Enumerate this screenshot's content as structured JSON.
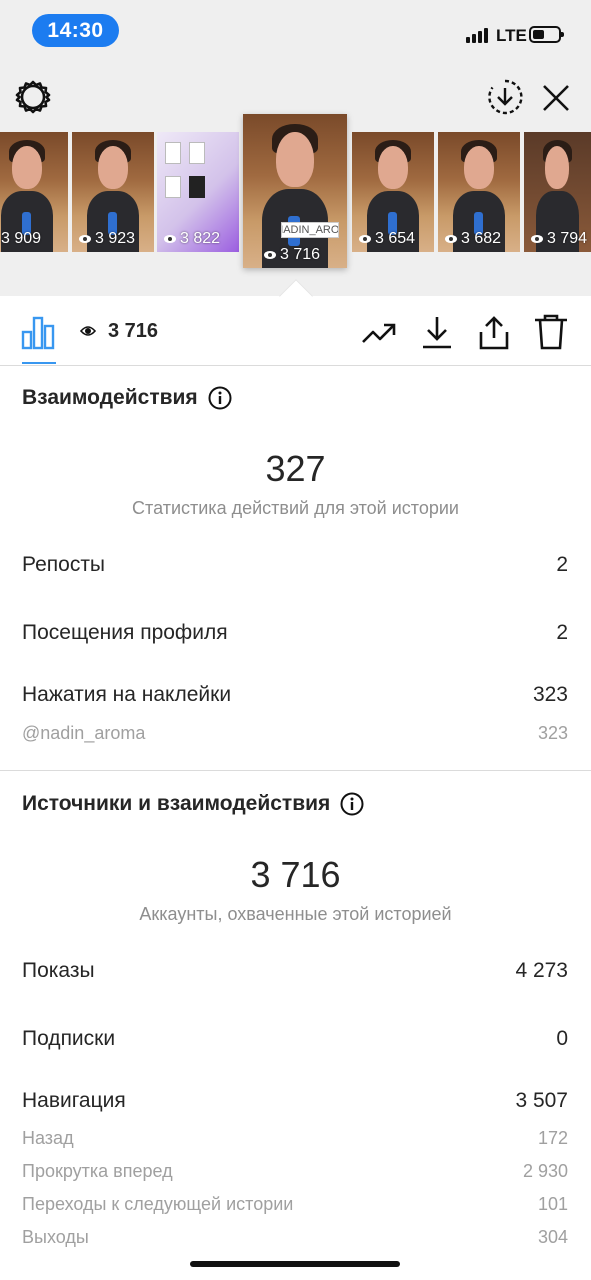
{
  "status_bar": {
    "time": "14:30",
    "network": "LTE"
  },
  "thumbnails": [
    {
      "views": "3 909",
      "kind": "person"
    },
    {
      "views": "3 923",
      "kind": "person"
    },
    {
      "views": "3 822",
      "kind": "product"
    },
    {
      "views": "3 716",
      "kind": "person",
      "active": true,
      "sticker": "@NADIN_AROMA"
    },
    {
      "views": "3 654",
      "kind": "person"
    },
    {
      "views": "3 682",
      "kind": "person"
    },
    {
      "views": "3 794",
      "kind": "person"
    }
  ],
  "tabbar": {
    "views": "3 716"
  },
  "interactions": {
    "title": "Взаимодействия",
    "total": "327",
    "subtitle": "Статистика действий для этой истории",
    "rows": [
      {
        "label": "Репосты",
        "value": "2"
      },
      {
        "label": "Посещения профиля",
        "value": "2"
      },
      {
        "label": "Нажатия на наклейки",
        "value": "323"
      }
    ],
    "sub_rows": [
      {
        "label": "@nadin_aroma",
        "value": "323"
      }
    ]
  },
  "discovery": {
    "title": "Источники и взаимодействия",
    "total": "3 716",
    "subtitle": "Аккаунты, охваченные этой историей",
    "rows": [
      {
        "label": "Показы",
        "value": "4 273"
      },
      {
        "label": "Подписки",
        "value": "0"
      },
      {
        "label": "Навигация",
        "value": "3 507"
      }
    ],
    "sub_rows": [
      {
        "label": "Назад",
        "value": "172"
      },
      {
        "label": "Прокрутка вперед",
        "value": "2 930"
      },
      {
        "label": "Переходы к следующей истории",
        "value": "101"
      },
      {
        "label": "Выходы",
        "value": "304"
      }
    ]
  },
  "colors": {
    "accent": "#3897f0",
    "time_pill": "#1c7cf0",
    "text": "#262626",
    "secondary": "#8e8e8e"
  }
}
